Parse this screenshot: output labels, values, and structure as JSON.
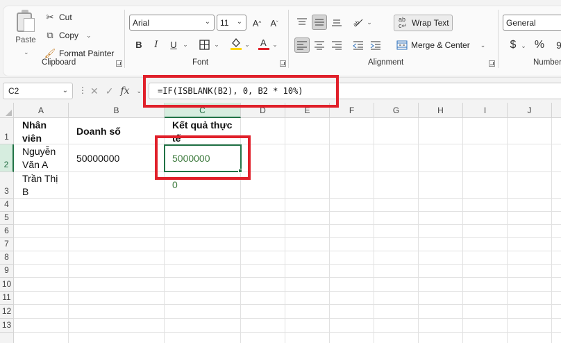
{
  "clipboard": {
    "group_label": "Clipboard",
    "paste_label": "Paste",
    "cut_label": "Cut",
    "copy_label": "Copy",
    "format_painter_label": "Format Painter"
  },
  "font": {
    "group_label": "Font",
    "font_name": "Arial",
    "font_size": "11",
    "bold": "B",
    "italic": "I",
    "underline": "U"
  },
  "alignment": {
    "group_label": "Alignment",
    "wrap_text_label": "Wrap Text",
    "merge_center_label": "Merge & Center"
  },
  "number": {
    "group_label": "Number",
    "format": "General",
    "currency_symbol": "$",
    "percent_symbol": "%"
  },
  "formula_bar": {
    "name_box": "C2",
    "fx_label": "fx",
    "formula": "=IF(ISBLANK(B2), 0, B2 * 10%)"
  },
  "grid": {
    "columns": [
      "A",
      "B",
      "C",
      "D",
      "E",
      "F",
      "G",
      "H",
      "I",
      "J"
    ],
    "rows": [
      "1",
      "2",
      "3",
      "4",
      "5",
      "6",
      "7",
      "8",
      "9",
      "10",
      "11",
      "12",
      "13"
    ],
    "selected_column": "C",
    "selected_row": "2",
    "cells": {
      "A1": "Nhân viên",
      "B1": "Doanh số",
      "C1": "Kết quả thực tế",
      "A2": "Nguyễn Văn A",
      "B2": "50000000",
      "C2": "5000000",
      "A3": "Trần Thị B",
      "C3": "0"
    }
  },
  "colors": {
    "accent_green": "#217346",
    "highlight_red": "#e0202a",
    "font_color_underline": "#e0202a",
    "fill_color_underline": "#ffd600"
  }
}
